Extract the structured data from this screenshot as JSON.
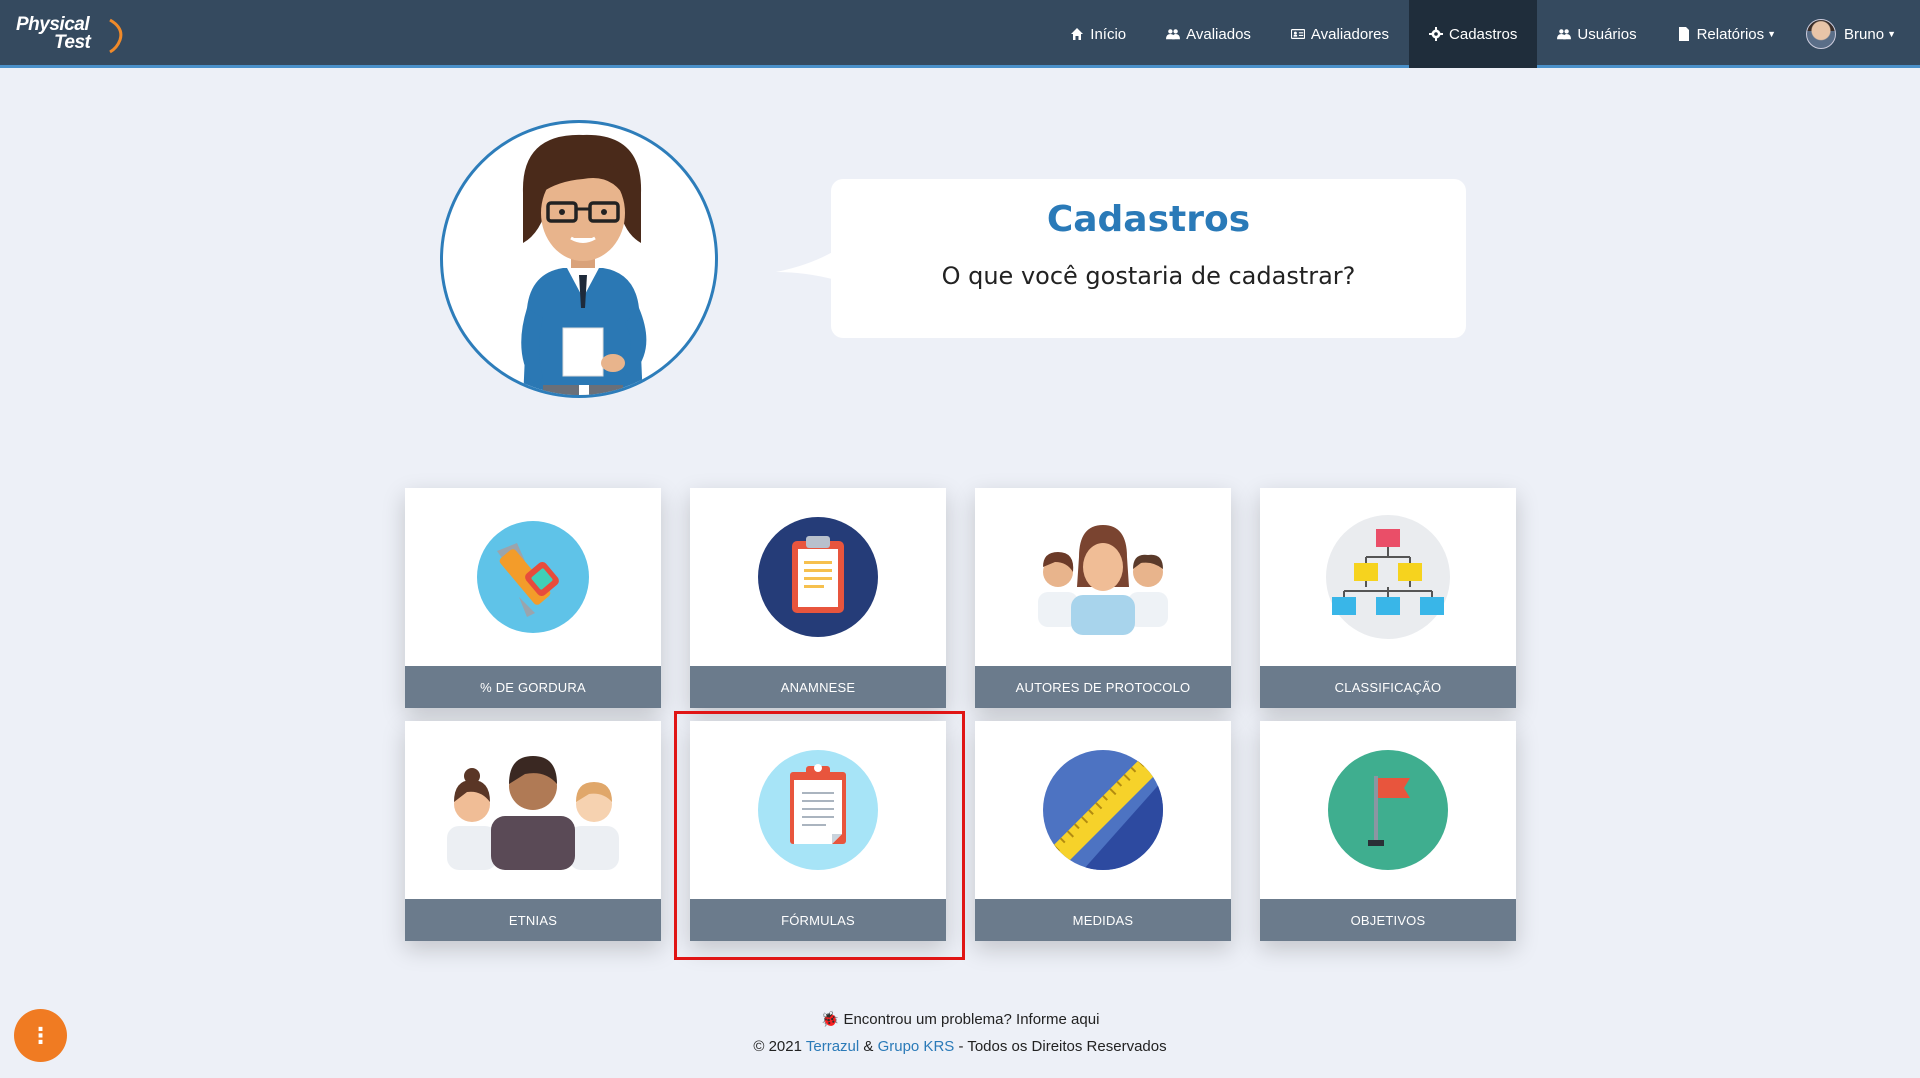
{
  "app": {
    "logo_line1": "Physical",
    "logo_line2": "Test"
  },
  "nav": {
    "items": [
      {
        "label": "Início",
        "icon": "home-icon"
      },
      {
        "label": "Avaliados",
        "icon": "users-icon"
      },
      {
        "label": "Avaliadores",
        "icon": "id-card-icon"
      },
      {
        "label": "Cadastros",
        "icon": "gear-icon",
        "active": true
      },
      {
        "label": "Usuários",
        "icon": "users-icon"
      },
      {
        "label": "Relatórios",
        "icon": "file-icon",
        "dropdown": true
      }
    ],
    "user_name": "Bruno"
  },
  "hero": {
    "title": "Cadastros",
    "subtitle": "O que você gostaria de cadastrar?"
  },
  "cards": [
    {
      "label": "% DE GORDURA",
      "icon": "caliper-icon"
    },
    {
      "label": "ANAMNESE",
      "icon": "clipboard-icon"
    },
    {
      "label": "AUTORES DE PROTOCOLO",
      "icon": "people-group-icon"
    },
    {
      "label": "CLASSIFICAÇÃO",
      "icon": "hierarchy-icon"
    },
    {
      "label": "ETNIAS",
      "icon": "ethnicities-icon"
    },
    {
      "label": "FÓRMULAS",
      "icon": "document-clipboard-icon",
      "highlighted": true
    },
    {
      "label": "MEDIDAS",
      "icon": "ruler-icon"
    },
    {
      "label": "OBJETIVOS",
      "icon": "flag-icon"
    }
  ],
  "footer": {
    "report_text": "Encontrou um problema? Informe aqui",
    "copyright_prefix": "© 2021 ",
    "company1": "Terrazul",
    "amp": " & ",
    "company2": "Grupo KRS",
    "suffix": " - Todos os Direitos Reservados"
  },
  "colors": {
    "navbar": "#354a5f",
    "accent": "#2a7ab8",
    "card_label": "#6b7b8c",
    "highlight": "#e01515",
    "fab": "#f07b22"
  }
}
